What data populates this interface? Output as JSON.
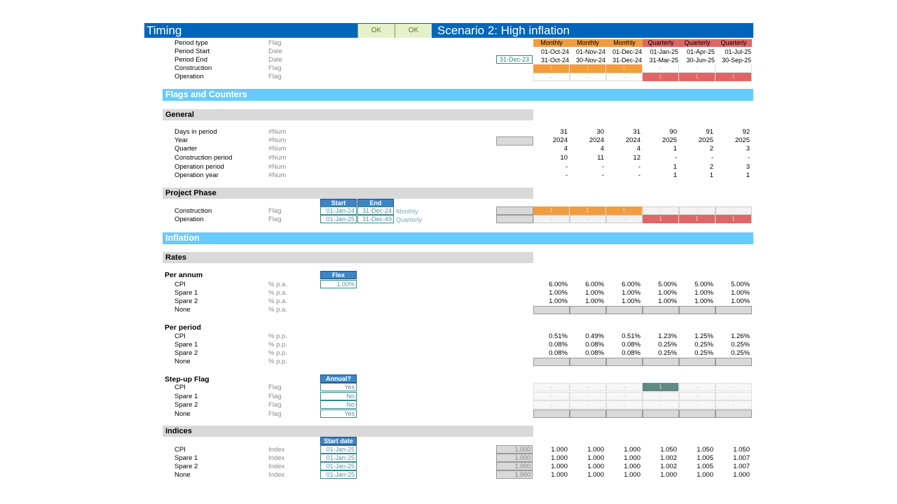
{
  "header": {
    "title": "Timing",
    "ok1": "OK",
    "ok2": "OK",
    "scenario": "Scenario 2: High inflation"
  },
  "colors": {
    "header_blue": "#0066bb",
    "section_blue": "#66ccff",
    "subsection_grey": "#d9d9d9",
    "monthly_orange": "#f39c3d",
    "quarterly_red": "#e06666",
    "check_green_bg": "#e6f1c9",
    "stepup_dark": "#5f8a84"
  },
  "timing": {
    "anchor_date": "31-Dec-23",
    "rows": [
      {
        "label": "Period type",
        "unit": "Flag"
      },
      {
        "label": "Period Start",
        "unit": "Date"
      },
      {
        "label": "Period End",
        "unit": "Date"
      },
      {
        "label": "Construction",
        "unit": "Flag"
      },
      {
        "label": "Operation",
        "unit": "Flag"
      }
    ],
    "period_type": [
      "Monthly",
      "Monthly",
      "Monthly",
      "Quarterly",
      "Quarterly",
      "Quarterly"
    ],
    "period_start": [
      "01-Oct-24",
      "01-Nov-24",
      "01-Dec-24",
      "01-Jan-25",
      "01-Apr-25",
      "01-Jul-25"
    ],
    "period_end": [
      "31-Oct-24",
      "30-Nov-24",
      "31-Dec-24",
      "31-Mar-25",
      "30-Jun-25",
      "30-Sep-25"
    ],
    "construction": [
      "1",
      "1",
      "1",
      "-",
      "-",
      "-"
    ],
    "operation": [
      "-",
      "-",
      "-",
      "1",
      "1",
      "1"
    ]
  },
  "flags_counters": {
    "title": "Flags and Counters",
    "general": {
      "title": "General",
      "rows": [
        {
          "label": "Days in period",
          "unit": "#Num",
          "values": [
            "31",
            "30",
            "31",
            "90",
            "91",
            "92"
          ]
        },
        {
          "label": "Year",
          "unit": "#Num",
          "values": [
            "2024",
            "2024",
            "2024",
            "2025",
            "2025",
            "2025"
          ]
        },
        {
          "label": "Quarter",
          "unit": "#Num",
          "values": [
            "4",
            "4",
            "4",
            "1",
            "2",
            "3"
          ]
        },
        {
          "label": "Construction period",
          "unit": "#Num",
          "values": [
            "10",
            "11",
            "12",
            "-",
            "-",
            "-"
          ]
        },
        {
          "label": "Operation period",
          "unit": "#Num",
          "values": [
            "-",
            "-",
            "-",
            "1",
            "2",
            "3"
          ]
        },
        {
          "label": "Operation year",
          "unit": "#Num",
          "values": [
            "-",
            "-",
            "-",
            "1",
            "1",
            "1"
          ]
        }
      ]
    },
    "project_phase": {
      "title": "Project Phase",
      "col_start": "Start",
      "col_end": "End",
      "rows": [
        {
          "label": "Construction",
          "unit": "Flag",
          "start": "01-Jan-24",
          "end": "31-Dec-24",
          "mode": "Monthly",
          "values": [
            "1",
            "1",
            "1",
            "-",
            "-",
            "-"
          ]
        },
        {
          "label": "Operation",
          "unit": "Flag",
          "start": "01-Jan-25",
          "end": "31-Dec-49",
          "mode": "Quarterly",
          "values": [
            "-",
            "-",
            "-",
            "1",
            "1",
            "1"
          ]
        }
      ]
    }
  },
  "inflation": {
    "title": "Inflation",
    "rates_title": "Rates",
    "per_annum": {
      "title": "Per annum",
      "flex_header": "Flex",
      "flex_value": "1.00%",
      "rows": [
        {
          "label": "CPI",
          "unit": "% p.a.",
          "values": [
            "6.00%",
            "6.00%",
            "6.00%",
            "5.00%",
            "5.00%",
            "5.00%"
          ]
        },
        {
          "label": "Spare 1",
          "unit": "% p.a.",
          "values": [
            "1.00%",
            "1.00%",
            "1.00%",
            "1.00%",
            "1.00%",
            "1.00%"
          ]
        },
        {
          "label": "Spare 2",
          "unit": "% p.a.",
          "values": [
            "1.00%",
            "1.00%",
            "1.00%",
            "1.00%",
            "1.00%",
            "1.00%"
          ]
        },
        {
          "label": "None",
          "unit": "% p.a.",
          "values": []
        }
      ]
    },
    "per_period": {
      "title": "Per period",
      "rows": [
        {
          "label": "CPI",
          "unit": "% p.p.",
          "values": [
            "0.51%",
            "0.49%",
            "0.51%",
            "1.23%",
            "1.25%",
            "1.26%"
          ]
        },
        {
          "label": "Spare 1",
          "unit": "% p.p.",
          "values": [
            "0.08%",
            "0.08%",
            "0.08%",
            "0.25%",
            "0.25%",
            "0.25%"
          ]
        },
        {
          "label": "Spare 2",
          "unit": "% p.p.",
          "values": [
            "0.08%",
            "0.08%",
            "0.08%",
            "0.25%",
            "0.25%",
            "0.25%"
          ]
        },
        {
          "label": "None",
          "unit": "% p.p.",
          "values": []
        }
      ]
    },
    "stepup": {
      "title": "Step-up Flag",
      "annual_header": "Annual?",
      "rows": [
        {
          "label": "CPI",
          "unit": "Flag",
          "annual": "Yes",
          "values": [
            "-",
            "-",
            "-",
            "1",
            "-",
            "-"
          ]
        },
        {
          "label": "Spare 1",
          "unit": "Flag",
          "annual": "No",
          "values": [
            "-",
            "-",
            "-",
            "-",
            "-",
            "-"
          ]
        },
        {
          "label": "Spare 2",
          "unit": "Flag",
          "annual": "No",
          "values": [
            "-",
            "-",
            "-",
            "-",
            "-",
            "-"
          ]
        },
        {
          "label": "None",
          "unit": "Flag",
          "annual": "Yes",
          "values": []
        }
      ]
    },
    "indices": {
      "title": "Indices",
      "start_header": "Start date",
      "rows": [
        {
          "label": "CPI",
          "unit": "Index",
          "start": "01-Jan-25",
          "base": "1.000",
          "values": [
            "1.000",
            "1.000",
            "1.000",
            "1.050",
            "1.050",
            "1.050"
          ]
        },
        {
          "label": "Spare 1",
          "unit": "Index",
          "start": "01-Jan-25",
          "base": "1.000",
          "values": [
            "1.000",
            "1.000",
            "1.000",
            "1.002",
            "1.005",
            "1.007"
          ]
        },
        {
          "label": "Spare 2",
          "unit": "Index",
          "start": "01-Jan-25",
          "base": "1.000",
          "values": [
            "1.000",
            "1.000",
            "1.000",
            "1.002",
            "1.005",
            "1.007"
          ]
        },
        {
          "label": "None",
          "unit": "Index",
          "start": "01-Jan-25",
          "base": "1.000",
          "values": [
            "1.000",
            "1.000",
            "1.000",
            "1.000",
            "1.000",
            "1.000"
          ]
        }
      ]
    }
  }
}
